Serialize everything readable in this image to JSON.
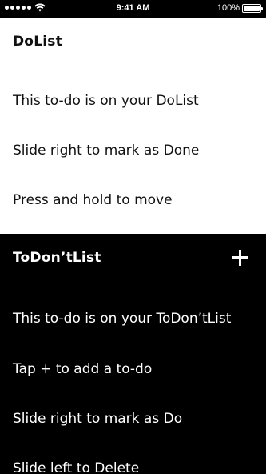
{
  "status_bar": {
    "time": "9:41 AM",
    "battery": "100%",
    "battery_level": 1.0,
    "signal_icon": "signal-dots-icon",
    "wifi_icon": "wifi-icon"
  },
  "dolist": {
    "title": "DoList",
    "items": [
      {
        "label": "This to-do is on your DoList"
      },
      {
        "label": "Slide right to mark as Done"
      },
      {
        "label": "Press and hold to move"
      }
    ]
  },
  "todontlist": {
    "title": "ToDon’tList",
    "add_icon": "plus-icon",
    "items": [
      {
        "label": "This to-do is on your ToDon’tList"
      },
      {
        "label": "Tap + to add a to-do"
      },
      {
        "label": "Slide right to mark as Do"
      },
      {
        "label": "Slide left to Delete"
      }
    ]
  },
  "colors": {
    "light_bg": "#ffffff",
    "dark_bg": "#000000",
    "text_dark": "#111111",
    "text_light": "#ffffff"
  }
}
